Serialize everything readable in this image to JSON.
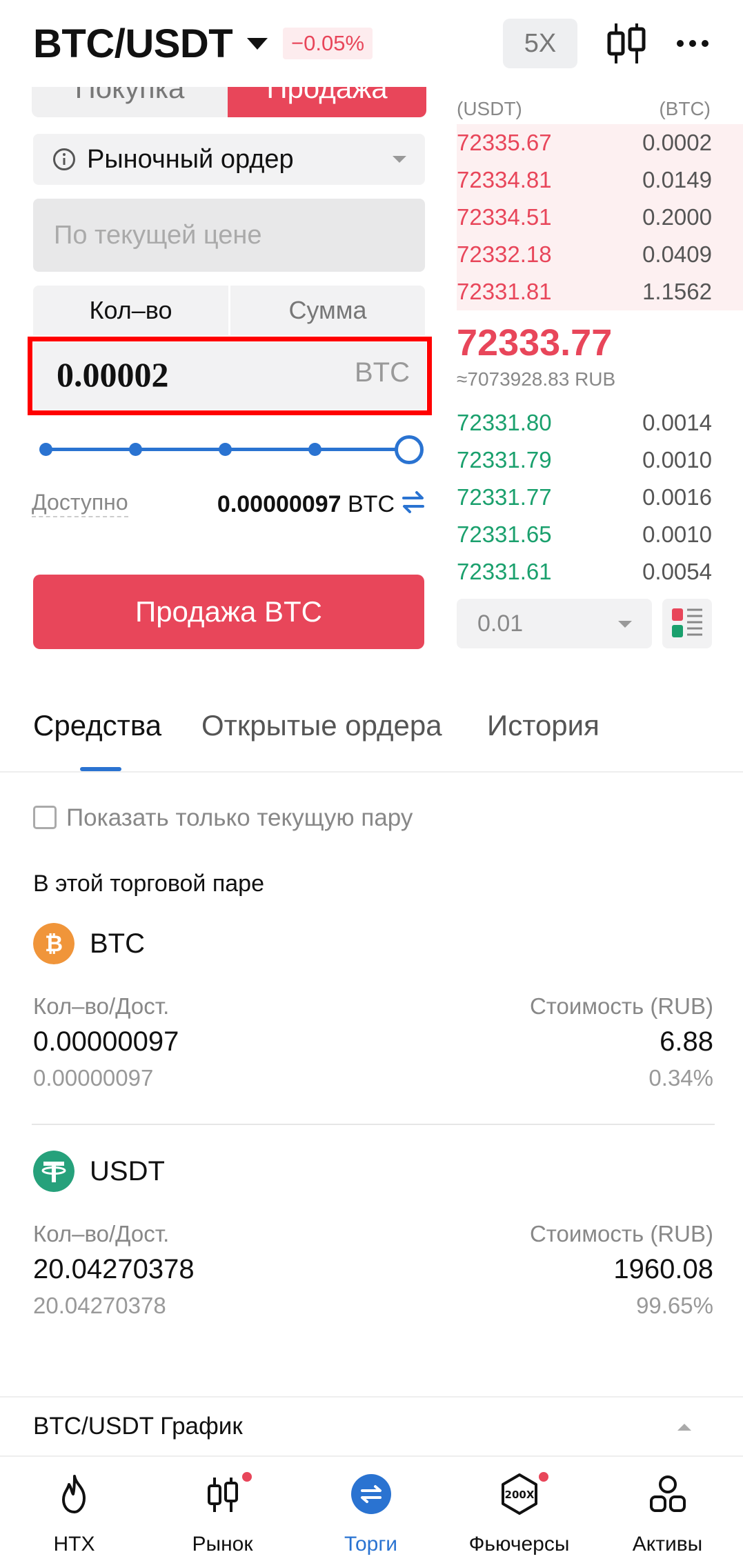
{
  "header": {
    "pair": "BTC/USDT",
    "change": "−0.05%",
    "leverage": "5X"
  },
  "trade": {
    "buy_tab": "Покупка",
    "sell_tab": "Продажа",
    "order_type": "Рыночный ордер",
    "price_placeholder": "По текущей цене",
    "mode_qty": "Кол–во",
    "mode_sum": "Сумма",
    "amount": "0.00002",
    "amount_unit": "BTC",
    "slider_percent": 100,
    "available_label": "Доступно",
    "available_value": "0.00000097",
    "available_unit": "BTC",
    "sell_button": "Продажа BTC"
  },
  "orderbook": {
    "price_header": "(USDT)",
    "amount_header": "(BTC)",
    "asks": [
      {
        "price": "72335.67",
        "amount": "0.0002"
      },
      {
        "price": "72334.81",
        "amount": "0.0149"
      },
      {
        "price": "72334.51",
        "amount": "0.2000"
      },
      {
        "price": "72332.18",
        "amount": "0.0409"
      },
      {
        "price": "72331.81",
        "amount": "1.1562"
      }
    ],
    "mid_price": "72333.77",
    "mid_rub": "≈7073928.83 RUB",
    "bids": [
      {
        "price": "72331.80",
        "amount": "0.0014"
      },
      {
        "price": "72331.79",
        "amount": "0.0010"
      },
      {
        "price": "72331.77",
        "amount": "0.0016"
      },
      {
        "price": "72331.65",
        "amount": "0.0010"
      },
      {
        "price": "72331.61",
        "amount": "0.0054"
      }
    ],
    "depth": "0.01"
  },
  "tabs": {
    "funds": "Средства",
    "open_orders": "Открытые ордера",
    "history": "История"
  },
  "funds": {
    "show_current_pair": "Показать только текущую пару",
    "section_title": "В этой торговой паре",
    "assets": [
      {
        "name": "BTC",
        "qty_label": "Кол–во/Дост.",
        "value_label": "Стоимость (RUB)",
        "qty": "0.00000097",
        "value": "6.88",
        "avail": "0.00000097",
        "percent": "0.34%",
        "color": "#f0953a"
      },
      {
        "name": "USDT",
        "qty_label": "Кол–во/Дост.",
        "value_label": "Стоимость (RUB)",
        "qty": "20.04270378",
        "value": "1960.08",
        "avail": "20.04270378",
        "percent": "99.65%",
        "color": "#26a17b"
      }
    ]
  },
  "chart_bar": {
    "label": "BTC/USDT График"
  },
  "nav": {
    "items": [
      {
        "label": "HTX",
        "icon": "flame-icon"
      },
      {
        "label": "Рынок",
        "icon": "candles-icon"
      },
      {
        "label": "Торги",
        "icon": "trade-icon"
      },
      {
        "label": "Фьючерсы",
        "icon": "futures-200x-icon"
      },
      {
        "label": "Активы",
        "icon": "assets-icon"
      }
    ],
    "active": "Торги"
  },
  "colors": {
    "accent": "#2a73d1",
    "sell": "#e8465a",
    "buy": "#1aa06d"
  }
}
